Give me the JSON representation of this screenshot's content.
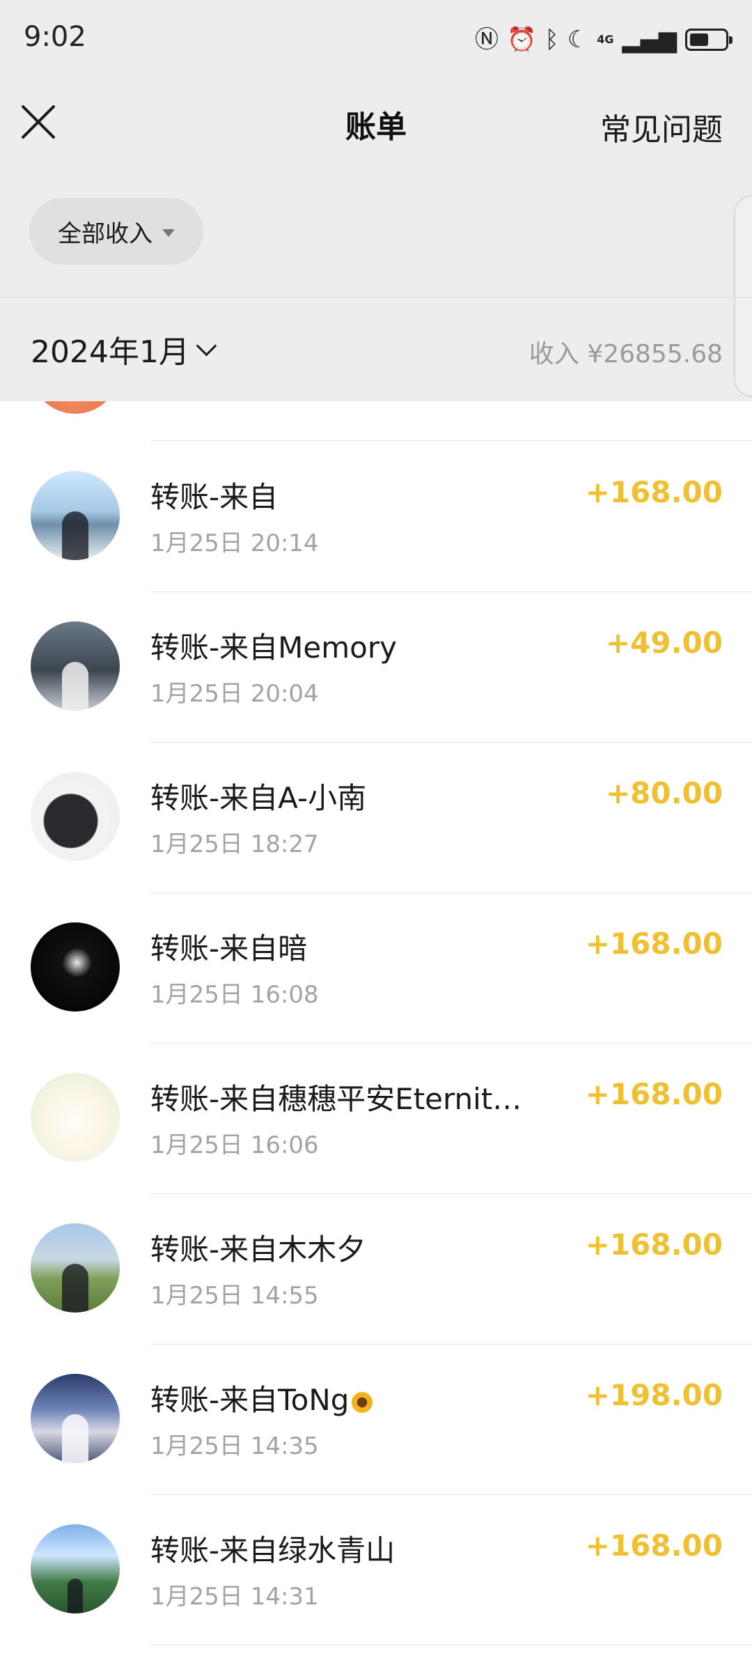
{
  "status_bar": {
    "time": "9:02",
    "network": "4G"
  },
  "nav": {
    "title": "账单",
    "faq": "常见问题"
  },
  "filter": {
    "label": "全部收入"
  },
  "month_header": {
    "month": "2024年1月",
    "income": "收入 ¥26855.68"
  },
  "colors": {
    "amount": "#f0c033",
    "background": "#ededed",
    "muted_text": "#a3a3a3"
  },
  "transactions": [
    {
      "title": "转账-来自",
      "time": "1月25日 20:14",
      "amount": "+168.00"
    },
    {
      "title": "转账-来自Memory",
      "time": "1月25日 20:04",
      "amount": "+49.00"
    },
    {
      "title": "转账-来自A-小南",
      "time": "1月25日 18:27",
      "amount": "+80.00"
    },
    {
      "title": "转账-来自暗",
      "time": "1月25日 16:08",
      "amount": "+168.00"
    },
    {
      "title": "转账-来自穗穗平安Eternit…",
      "time": "1月25日 16:06",
      "amount": "+168.00"
    },
    {
      "title": "转账-来自木木夕",
      "time": "1月25日 14:55",
      "amount": "+168.00"
    },
    {
      "title": "转账-来自ToNg",
      "time": "1月25日 14:35",
      "amount": "+198.00"
    },
    {
      "title": "转账-来自绿水青山",
      "time": "1月25日 14:31",
      "amount": "+168.00"
    }
  ]
}
